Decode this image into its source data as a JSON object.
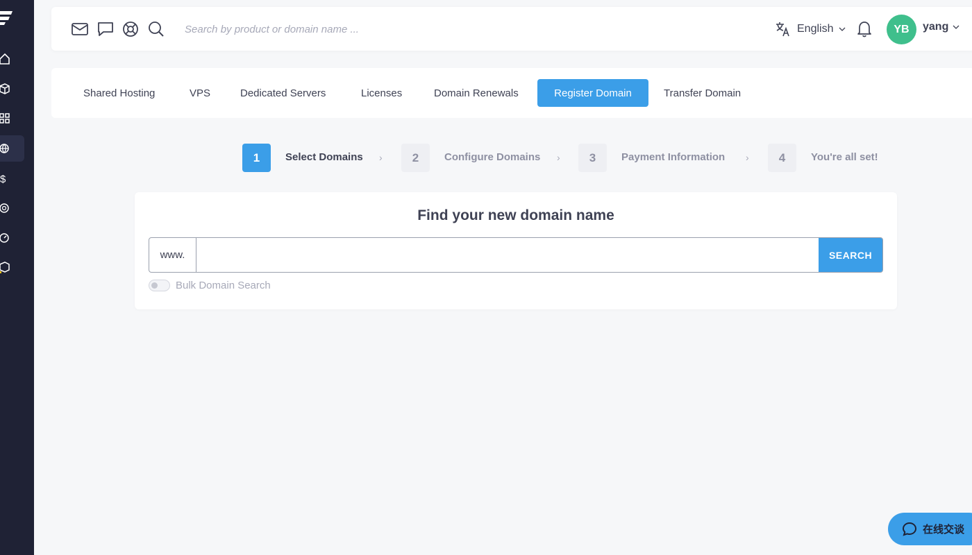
{
  "topbar": {
    "search_placeholder": "Search by product or domain name ...",
    "language": "English",
    "user_initials": "YB",
    "user_name": "yang"
  },
  "tabs": [
    {
      "label": "Shared Hosting",
      "active": false
    },
    {
      "label": "VPS",
      "active": false
    },
    {
      "label": "Dedicated Servers",
      "active": false
    },
    {
      "label": "Licenses",
      "active": false
    },
    {
      "label": "Domain Renewals",
      "active": false
    },
    {
      "label": "Register Domain",
      "active": true
    },
    {
      "label": "Transfer Domain",
      "active": false
    }
  ],
  "steps": [
    {
      "number": "1",
      "label": "Select Domains",
      "active": true
    },
    {
      "number": "2",
      "label": "Configure Domains",
      "active": false
    },
    {
      "number": "3",
      "label": "Payment Information",
      "active": false
    },
    {
      "number": "4",
      "label": "You're all set!",
      "active": false
    }
  ],
  "domain_search": {
    "title": "Find your new domain name",
    "prefix": "www.",
    "value": "",
    "button_label": "SEARCH",
    "bulk_label": "Bulk Domain Search",
    "bulk_enabled": false
  },
  "chat": {
    "label": "在线交谈"
  },
  "colors": {
    "accent": "#3b9ee8",
    "sidebar": "#1f2235",
    "avatar": "#3fbf8c",
    "background": "#f6f7f9"
  }
}
